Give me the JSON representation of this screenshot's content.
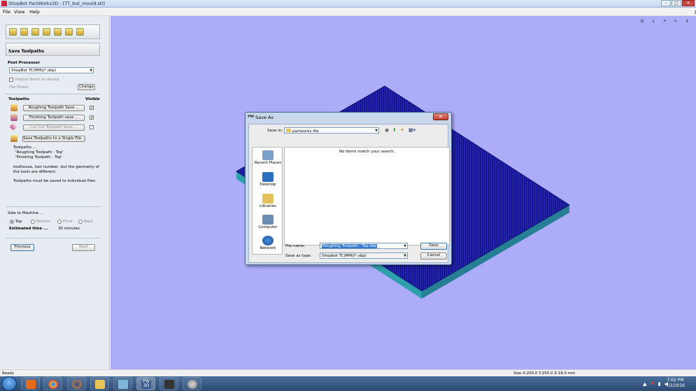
{
  "window": {
    "title": "ShopBot PartWorks3D - [TT_bat_mould.stl]"
  },
  "menu": {
    "file": "File",
    "view": "View",
    "help": "Help"
  },
  "panel": {
    "section_title": "Save Toolpaths",
    "post_processor_label": "Post Processor",
    "post_processor_value": "ShopBot TC(MM)(*.sbp)",
    "output_direct_label": "Output direct to device",
    "file_direct_label": "File Direct",
    "change_button": "Change",
    "toolpaths_header": "Toolpaths",
    "visible_header": "Visible",
    "toolpaths": [
      {
        "label": "Roughing Toolpath Save ...",
        "visible": true
      },
      {
        "label": "Finishing Toolpath save ...",
        "visible": true
      },
      {
        "label": "Cut Out Toolpath Save ...",
        "visible": false
      }
    ],
    "save_single_button": "Save Toolpaths to a Single File ...",
    "info_lines": [
      "Toolpaths ...",
      "'Roughing Toolpath - Top'",
      "'Finishing Toolpath - Top'",
      "toolhouse, tool number, but the geometry of",
      "the tools are different.",
      "",
      "Toolpaths must be saved to individual files"
    ],
    "side_label": "Side to Machine ...",
    "sides": [
      {
        "label": "Top",
        "selected": true
      },
      {
        "label": "Bottom",
        "selected": false
      },
      {
        "label": "Front",
        "selected": false
      },
      {
        "label": "Back",
        "selected": false
      }
    ],
    "estimated_label": "Estimated time ...",
    "estimated_value": "30 minutes",
    "previous_button": "Previous",
    "next_button": "Next"
  },
  "viewport": {
    "view_buttons": [
      "⊡",
      "↓",
      "↗",
      "↖",
      "↕"
    ]
  },
  "dialog": {
    "title": "Save As",
    "save_in_label": "Save in:",
    "save_in_value": "partworks file",
    "places": [
      "Recent Places",
      "Desktop",
      "Libraries",
      "Computer",
      "Network"
    ],
    "empty_message": "No items match your search.",
    "file_name_label": "File name:",
    "file_name_value": "Roughing Toolpath - Top.sbp",
    "save_type_label": "Save as type:",
    "save_type_value": "Shopbot TC(MM)(*.sbp)",
    "save_button": "Save",
    "cancel_button": "Cancel"
  },
  "status": {
    "left": "Ready",
    "right": "Size X:200.0 Y:250.0 Z:18.0 mm"
  },
  "clock": {
    "time": "7:02 PM",
    "date": "7/2/2016"
  },
  "colors": {
    "viewport_bg": "#acacf8",
    "toolpath_blue": "#1e1e9e",
    "stock_teal": "#2e9aa9"
  }
}
